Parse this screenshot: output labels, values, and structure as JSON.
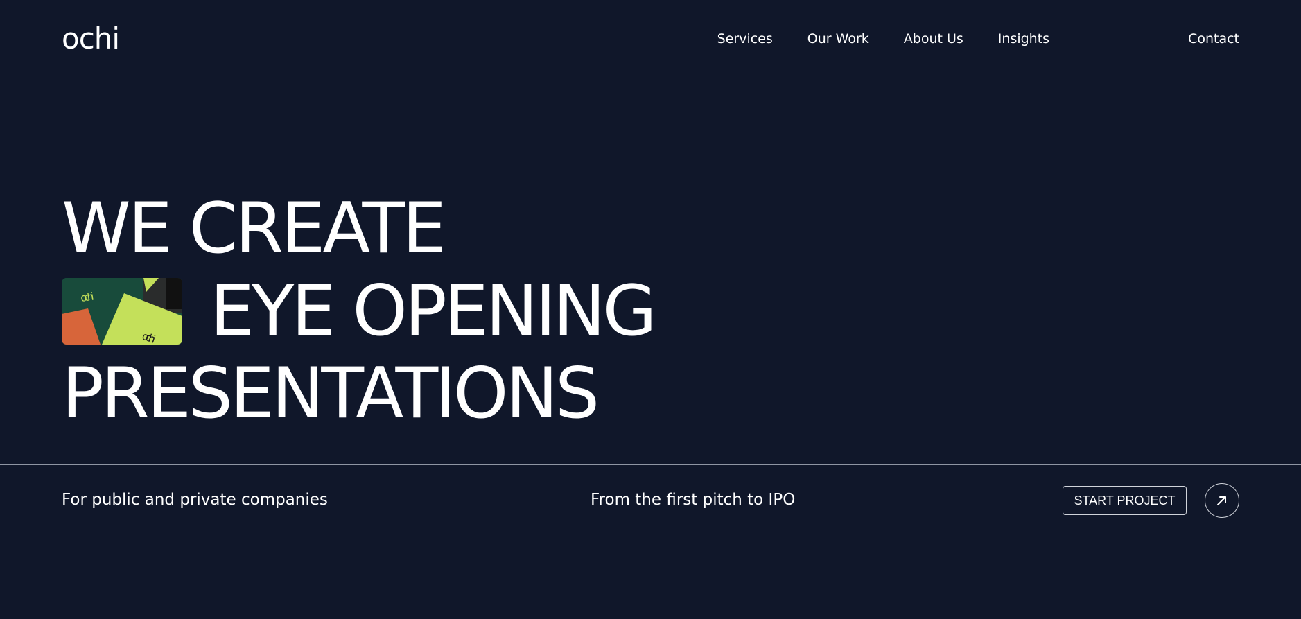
{
  "brand": {
    "logo_text": "ochi"
  },
  "nav": {
    "links": [
      {
        "label": "Services"
      },
      {
        "label": "Our Work"
      },
      {
        "label": "About Us"
      },
      {
        "label": "Insights"
      }
    ],
    "contact_label": "Contact"
  },
  "hero": {
    "line1": "WE CREATE",
    "line2": "EYE OPENING",
    "line3": "PRESENTATIONS",
    "thumb_text_a": "ochi",
    "thumb_text_b": "ochi"
  },
  "footer_strip": {
    "left_text": "For public and private companies",
    "mid_text": "From the first pitch to IPO",
    "cta_label": "START PROJECT",
    "arrow_icon": "arrow-up-right-icon"
  },
  "colors": {
    "background": "#10172a",
    "text": "#ffffff",
    "divider": "#8f95a3",
    "thumb_green": "#184b3b",
    "thumb_lime": "#c4e05a",
    "thumb_orange": "#d7653a"
  }
}
